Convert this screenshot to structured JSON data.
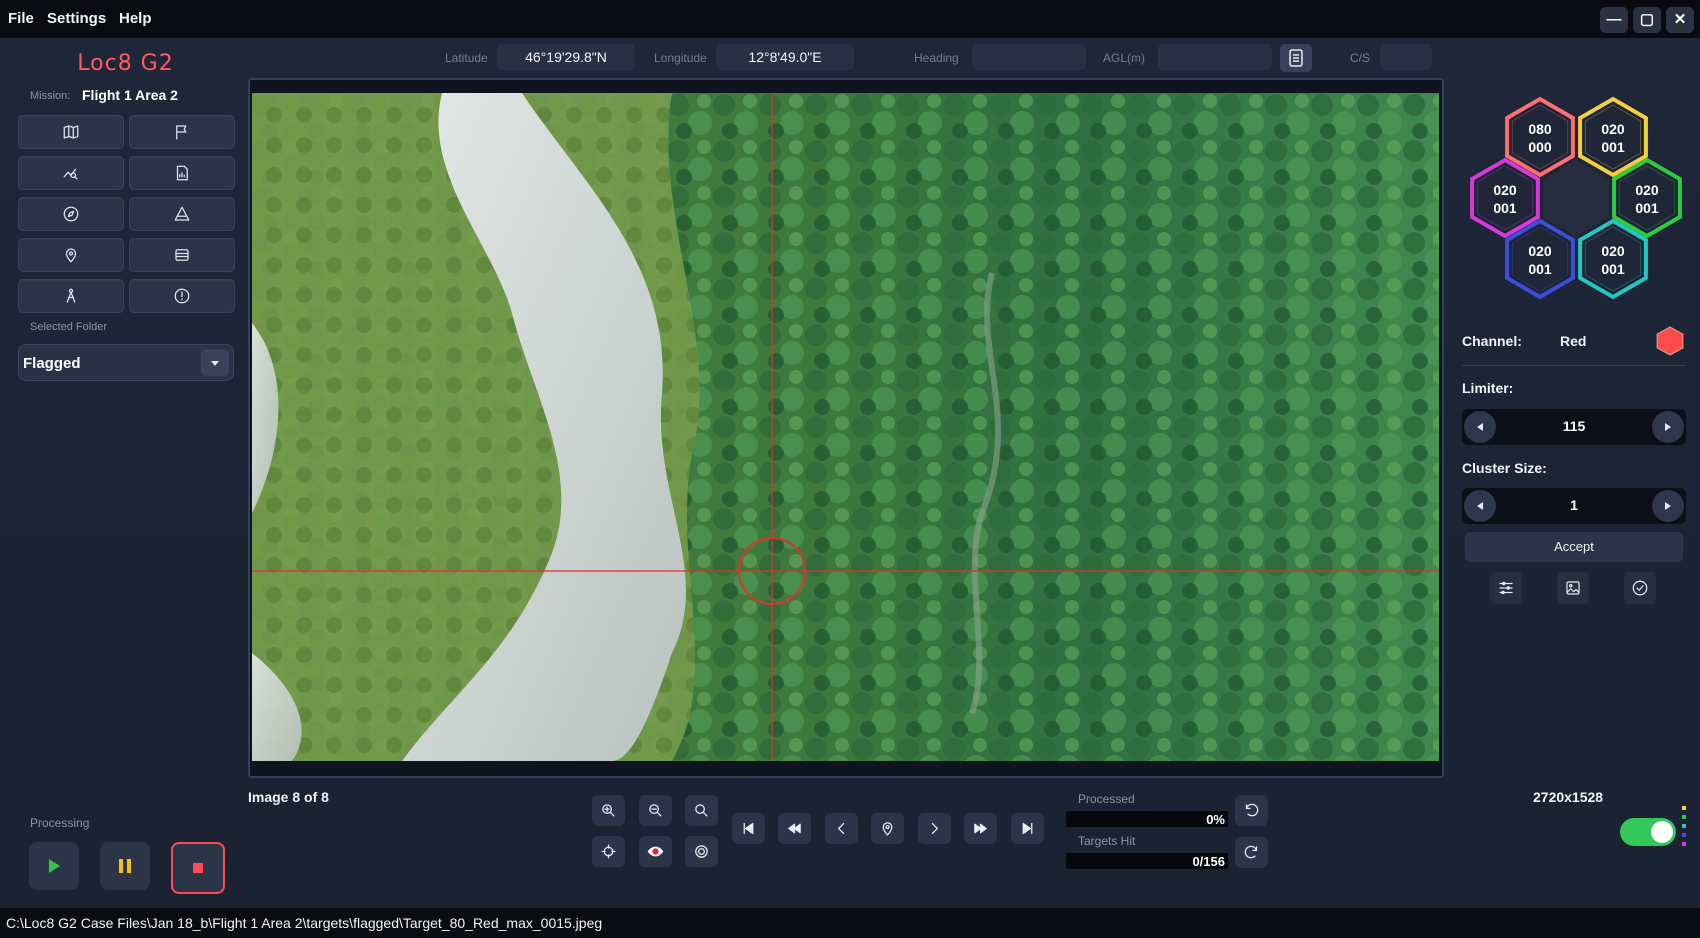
{
  "menu": {
    "file": "File",
    "settings": "Settings",
    "help": "Help"
  },
  "window_controls": {
    "minimize": "—",
    "maximize": "▢",
    "close": "✕"
  },
  "app": {
    "brand": "Loc8 G2"
  },
  "mission": {
    "label": "Mission:",
    "value": "Flight 1 Area 2"
  },
  "folder": {
    "label": "Selected Folder",
    "value": "Flagged"
  },
  "tools": [
    {
      "name": "map-icon"
    },
    {
      "name": "flag-icon"
    },
    {
      "name": "chart-search-icon"
    },
    {
      "name": "file-report-icon"
    },
    {
      "name": "compass-icon"
    },
    {
      "name": "terrain-icon"
    },
    {
      "name": "location-pin-icon"
    },
    {
      "name": "layers-icon"
    },
    {
      "name": "person-icon"
    },
    {
      "name": "info-icon"
    }
  ],
  "coords": {
    "latitude_label": "Latitude",
    "latitude": "46°19'29.8\"N",
    "longitude_label": "Longitude",
    "longitude": "12°8'49.0\"E",
    "heading_label": "Heading",
    "heading": "",
    "agl_label": "AGL(m)",
    "agl": "",
    "cs_label": "C/S",
    "cs": ""
  },
  "hexes": [
    {
      "line1": "080",
      "line2": "000",
      "color": "#ff6f6f"
    },
    {
      "line1": "020",
      "line2": "001",
      "color": "#f4d03f"
    },
    {
      "line1": "020",
      "line2": "001",
      "color": "#d63ad8"
    },
    {
      "line1": "020",
      "line2": "001",
      "color": "#2ecc40"
    },
    {
      "line1": "020",
      "line2": "001",
      "color": "#3b4fd8"
    },
    {
      "line1": "020",
      "line2": "001",
      "color": "#22c7c0"
    }
  ],
  "channel": {
    "label": "Channel:",
    "value": "Red",
    "color": "#ff4b4b"
  },
  "limiter": {
    "label": "Limiter:",
    "value": "115"
  },
  "cluster": {
    "label": "Cluster Size:",
    "value": "1"
  },
  "accept_label": "Accept",
  "viewer": {
    "image_index": "Image 8 of 8",
    "resolution": "2720x1528"
  },
  "progress": {
    "processed_label": "Processed",
    "processed_text": "0%",
    "processed_fraction": 0,
    "targets_label": "Targets Hit",
    "targets_text": "0/156",
    "targets_fraction": 0
  },
  "processing": {
    "label": "Processing"
  },
  "status": {
    "path": "C:\\Loc8 G2 Case Files\\Jan 18_b\\Flight 1 Area 2\\targets\\flagged\\Target_80_Red_max_0015.jpeg"
  },
  "colors": {
    "accent": "#ff5a5f",
    "toggle_on": "#34c759"
  }
}
